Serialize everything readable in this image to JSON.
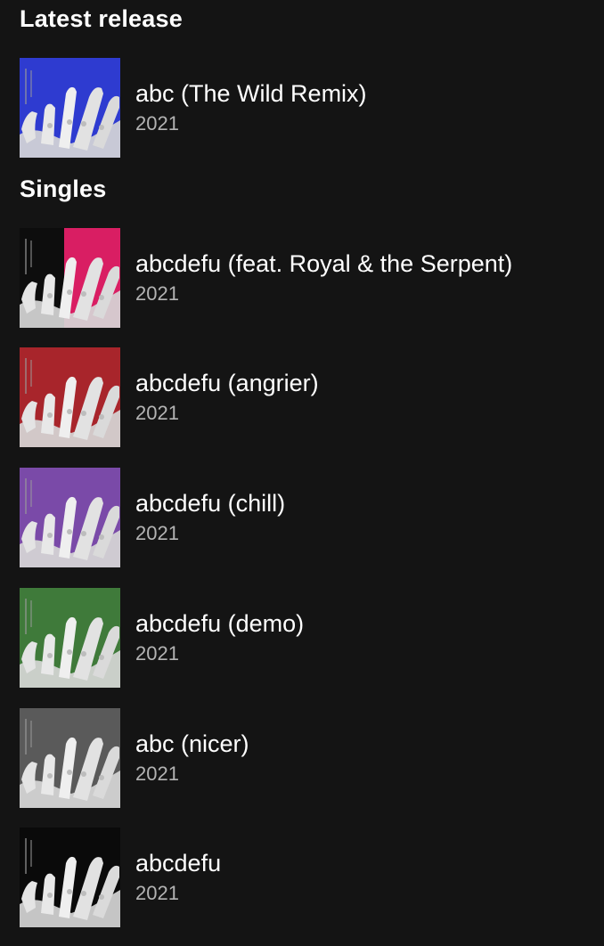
{
  "sections": {
    "latest": {
      "title": "Latest release"
    },
    "singles": {
      "title": "Singles"
    }
  },
  "latest": {
    "title": "abc (The Wild Remix)",
    "year": "2021",
    "cover_color": "#2e3bd0"
  },
  "singles": [
    {
      "title": "abcdefu (feat. Royal & the Serpent)",
      "year": "2021",
      "cover_color": "#d91e63"
    },
    {
      "title": "abcdefu (angrier)",
      "year": "2021",
      "cover_color": "#a8252b"
    },
    {
      "title": "abcdefu (chill)",
      "year": "2021",
      "cover_color": "#7a4aa8"
    },
    {
      "title": "abcdefu (demo)",
      "year": "2021",
      "cover_color": "#3f7a3a"
    },
    {
      "title": "abc (nicer)",
      "year": "2021",
      "cover_color": "#5a5a5a"
    },
    {
      "title": "abcdefu",
      "year": "2021",
      "cover_color": "#0a0a0a"
    }
  ]
}
